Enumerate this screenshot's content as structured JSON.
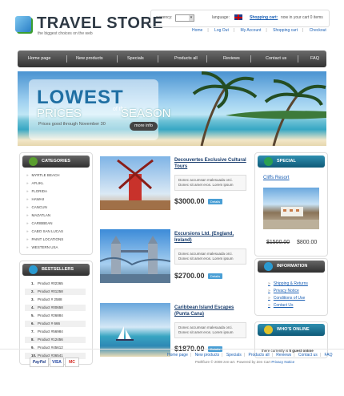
{
  "header": {
    "title": "TRAVEL STORE",
    "subtitle": "the biggest choices on the web",
    "currency_label": "currency:",
    "language_label": "language:",
    "cart_label": "Shopping cart:",
    "cart_text": "now in your cart 0 items",
    "links": [
      "Home",
      "Log Out",
      "My Account",
      "Shopping cart",
      "Checkout"
    ]
  },
  "nav": [
    "Home page",
    "New products",
    "Specials",
    "Products all",
    "Reviews",
    "Contact us",
    "FAQ"
  ],
  "banner": {
    "line1": "LOWEST",
    "line2a": "PRICES",
    "line2b": "of the",
    "line2c": "SEASON",
    "small": "Prices good through November 30",
    "more": "more info"
  },
  "categories": {
    "title": "CATEGORIES",
    "items": [
      "MYRTLE BEACH",
      "AFLIKL",
      "FLORIDA",
      "HAWAII",
      "CANCUN",
      "MAZATLAN",
      "CARIBBEAN",
      "CABO SAN LUCAS",
      "PAINT LOCATIONS",
      "WESTERN USA"
    ]
  },
  "bestsellers": {
    "title": "BESTSELLERS",
    "items": [
      {
        "n": "1.",
        "t": "Product #02365"
      },
      {
        "n": "2.",
        "t": "Product #01258"
      },
      {
        "n": "3.",
        "t": "Product # 2588"
      },
      {
        "n": "4.",
        "t": "Product #00658"
      },
      {
        "n": "5.",
        "t": "Product #26884"
      },
      {
        "n": "6.",
        "t": "Product # 666"
      },
      {
        "n": "7.",
        "t": "Product #56984"
      },
      {
        "n": "8.",
        "t": "Product #12456"
      },
      {
        "n": "9.",
        "t": "Product #45612"
      },
      {
        "n": "10.",
        "t": "Product #36541"
      }
    ]
  },
  "products": [
    {
      "title": "Decouvertes Exclusive Cultural Tours",
      "desc": "Donec accumsan malesuada orci. Donec sit amet eros. Lorem ipsum",
      "price": "$3000.00",
      "details": "Details"
    },
    {
      "title": "Excursions Ltd. (England, Ireland)",
      "desc": "Donec accumsan malesuada orci. Donec sit amet eros. Lorem ipsum",
      "price": "$2700.00",
      "details": "Details"
    },
    {
      "title": "Caribbean Island Escapes (Punta Cana)",
      "desc": "Donec accumsan malesuada orci. Donec sit amet eros. Lorem ipsum",
      "price": "$1870.00",
      "details": "Details"
    }
  ],
  "special": {
    "title": "SPECIAL",
    "product": "Cliffs Resort",
    "old_price": "$1500.00",
    "new_price": "$800.00"
  },
  "information": {
    "title": "INFORMATION",
    "items": [
      "Shipping & Returns",
      "Privacy Notice",
      "Conditions of Use",
      "Contact Us"
    ]
  },
  "whos_online": {
    "title": "WHO'S ONLINE",
    "text_pre": "there currently is ",
    "guest": "5 guest online"
  },
  "footer": {
    "links": [
      "Home page",
      "New products",
      "Specials",
      "Products all",
      "Reviews",
      "Contact us",
      "FAQ"
    ],
    "copyright": "Pathfiure © 2008 zen-art. Powered by Zen Cart",
    "privacy": "Privacy Notice",
    "payments": [
      "PayPal",
      "VISA",
      "MC"
    ]
  },
  "colors": {
    "brand_blue": "#1a5fb4",
    "nav_dark": "#333333",
    "details_button": "#4a9fd5"
  }
}
